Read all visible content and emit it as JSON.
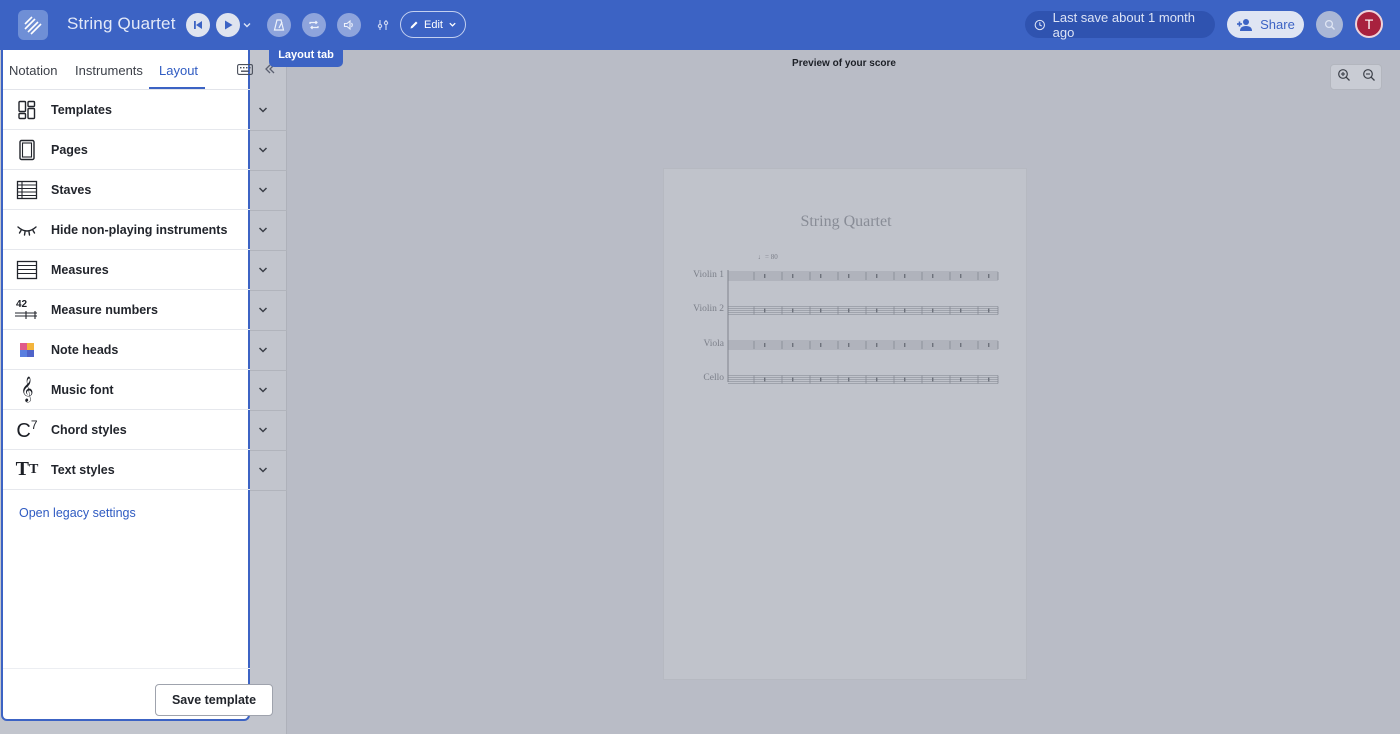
{
  "header": {
    "title": "String Quartet",
    "edit_label": "Edit",
    "save_status": "Last save about 1 month ago",
    "share_label": "Share",
    "avatar_initial": "T"
  },
  "tooltip": {
    "text": "Layout tab"
  },
  "panel": {
    "tabs": [
      {
        "label": "Notation",
        "active": false
      },
      {
        "label": "Instruments",
        "active": false
      },
      {
        "label": "Layout",
        "active": true
      }
    ],
    "items": [
      {
        "label": "Templates",
        "icon": "templates-icon"
      },
      {
        "label": "Pages",
        "icon": "pages-icon"
      },
      {
        "label": "Staves",
        "icon": "staves-icon"
      },
      {
        "label": "Hide non-playing instruments",
        "icon": "closed-eye-icon"
      },
      {
        "label": "Measures",
        "icon": "measures-icon"
      },
      {
        "label": "Measure numbers",
        "icon": "measure-numbers-icon",
        "icon_text": "42"
      },
      {
        "label": "Note heads",
        "icon": "note-heads-icon"
      },
      {
        "label": "Music font",
        "icon": "treble-clef-icon",
        "icon_text": "𝄞"
      },
      {
        "label": "Chord styles",
        "icon": "chord-icon",
        "icon_text": "C",
        "icon_sup": "7"
      },
      {
        "label": "Text styles",
        "icon": "text-styles-icon",
        "icon_text": "T",
        "icon_small": "T"
      }
    ],
    "legacy_link": "Open legacy settings",
    "save_template": "Save template"
  },
  "preview": {
    "label": "Preview of your score",
    "score_title": "String Quartet",
    "tempo": "♩= 80",
    "instruments": [
      "Violin 1",
      "Violin 2",
      "Viola",
      "Cello"
    ]
  },
  "colors": {
    "brand": "#3c63c4",
    "link": "#2f5bc2",
    "avatar": "#a8213e"
  }
}
